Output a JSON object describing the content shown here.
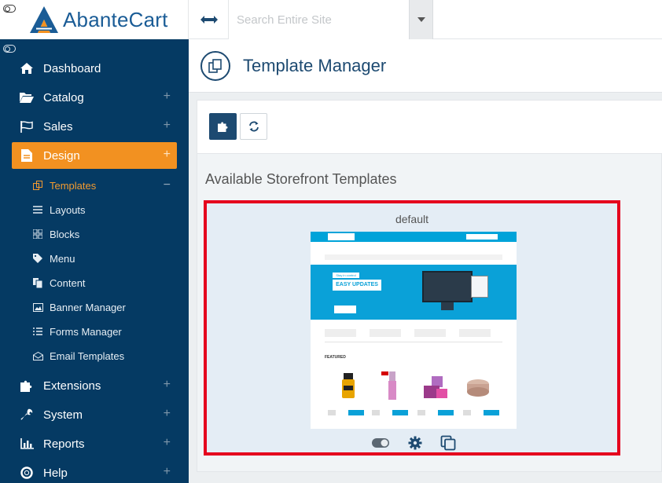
{
  "header": {
    "brand": "AbanteCart",
    "search_placeholder": "Search Entire Site"
  },
  "sidebar": {
    "items": [
      {
        "label": "Dashboard",
        "icon": "home-icon"
      },
      {
        "label": "Catalog",
        "icon": "folder-open-icon",
        "expand": "+"
      },
      {
        "label": "Sales",
        "icon": "flag-icon",
        "expand": "+"
      },
      {
        "label": "Design",
        "icon": "file-icon",
        "expand": "+",
        "active": true
      },
      {
        "label": "Extensions",
        "icon": "puzzle-icon",
        "expand": "+"
      },
      {
        "label": "System",
        "icon": "wrench-icon",
        "expand": "+"
      },
      {
        "label": "Reports",
        "icon": "bar-chart-icon",
        "expand": "+"
      },
      {
        "label": "Help",
        "icon": "life-ring-icon",
        "expand": "+"
      }
    ],
    "design_sub": [
      {
        "label": "Templates",
        "icon": "copy-icon",
        "active": true,
        "collapse": "−"
      },
      {
        "label": "Layouts",
        "icon": "list-icon"
      },
      {
        "label": "Blocks",
        "icon": "blocks-icon"
      },
      {
        "label": "Menu",
        "icon": "tag-icon"
      },
      {
        "label": "Content",
        "icon": "files-icon"
      },
      {
        "label": "Banner Manager",
        "icon": "image-icon"
      },
      {
        "label": "Forms Manager",
        "icon": "list-alt-icon"
      },
      {
        "label": "Email Templates",
        "icon": "envelope-icon"
      }
    ]
  },
  "page": {
    "title": "Template Manager",
    "section_title": "Available Storefront Templates"
  },
  "template": {
    "name": "default",
    "preview": {
      "banner_tag": "Stay in control",
      "banner_headline": "EASY UPDATES",
      "featured_label": "FEATURED"
    }
  },
  "colors": {
    "sidebar_bg": "#053a63",
    "active_orange": "#f29121",
    "primary_navy": "#1d4a71",
    "highlight_red": "#e5001d"
  }
}
